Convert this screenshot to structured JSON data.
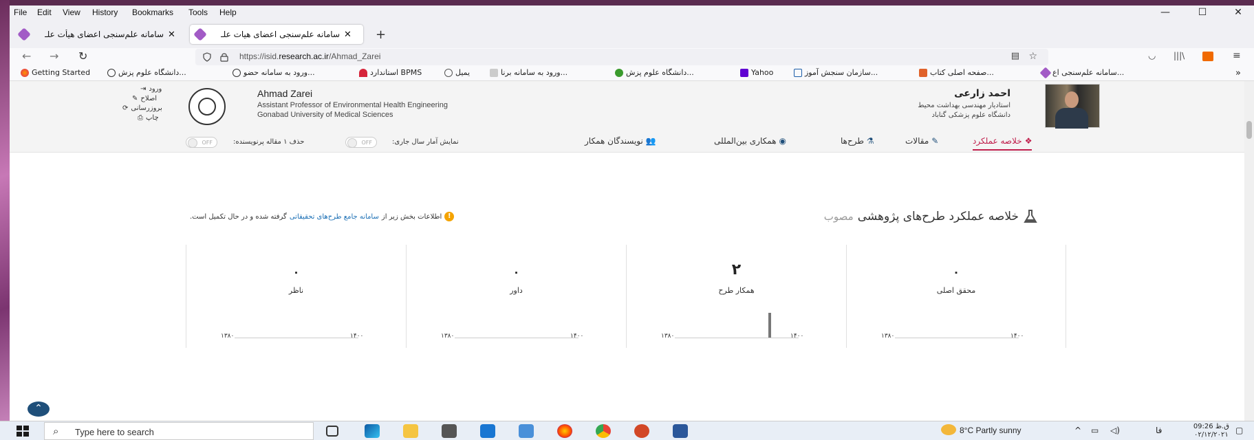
{
  "menubar": {
    "items": [
      "File",
      "Edit",
      "View",
      "History",
      "Bookmarks",
      "Tools",
      "Help"
    ],
    "minimize": "—",
    "maximize": "☐",
    "close": "✕"
  },
  "tabs": [
    {
      "title": "سامانه علم‌سنجی اعضای هیأت علـ",
      "close": "✕"
    },
    {
      "title": "سامانه علم‌سنجی اعضای هیات علـ",
      "close": "✕",
      "active": true
    }
  ],
  "newtab": "+",
  "nav": {
    "url_prefix": "https://isid.",
    "url_domain": "research.ac.ir",
    "url_path": "/Ahmad_Zarei",
    "back": "←",
    "forward": "→",
    "reload": "↻"
  },
  "bookmarks": [
    "Getting Started",
    "دانشگاه علوم پزش...",
    "ورود به سامانه حضو...",
    "استاندارد BPMS",
    "یمیل",
    "ورود به سامانه برنا...",
    "دانشگاه علوم پزش...",
    "Yahoo",
    "سازمان سنجش آموز...",
    "صفحه اصلی کتاب...",
    "سامانه علم‌سنجی اع..."
  ],
  "profile": {
    "en_name": "Ahmad Zarei",
    "en_title": "Assistant Professor of Environmental Health Engineering",
    "en_univ": "Gonabad University of Medical Sciences",
    "fa_name": "احمد زارعی",
    "fa_title": "استادیار مهندسی بهداشت محیط",
    "fa_univ": "دانشگاه علوم پزشکی گناباد",
    "links": {
      "login": "ورود",
      "edit": "اصلاح",
      "update": "بروزرسانی",
      "print": "چاپ"
    }
  },
  "page_tabs": {
    "summary": "خلاصه عملکرد",
    "articles": "مقالات",
    "projects": "طرح‌ها",
    "intl": "همکاری بین‌المللی",
    "coauthors": "نویسندگان همکار"
  },
  "toggles": {
    "current_year_label": "نمایش آمار سال جاری:",
    "remove_label": "حذف ۱ مقاله پرنویسنده:",
    "state": "OFF"
  },
  "section": {
    "title": "خلاصه عملکرد طرح‌های پژوهشی",
    "title_suffix": "مصوب",
    "notice_pre": "اطلاعات بخش زیر از",
    "notice_link": "سامانه جامع طرح‌های تحقیقاتی",
    "notice_post": "گرفته شده و در حال تکمیل است.",
    "notice_icon": "!"
  },
  "cards": [
    {
      "label": "ناظر",
      "value": "۰",
      "tick_start": "۱۳۸۰",
      "tick_end": "۱۴۰۰"
    },
    {
      "label": "داور",
      "value": "۰",
      "tick_start": "۱۳۸۰",
      "tick_end": "۱۴۰۰"
    },
    {
      "label": "همکار طرح",
      "value": "۲",
      "tick_start": "۱۳۸۰",
      "tick_end": "۱۴۰۰",
      "spark_peak_fraction": 0.7
    },
    {
      "label": "محقق اصلی",
      "value": "۰",
      "tick_start": "۱۳۸۰",
      "tick_end": "۱۴۰۰"
    }
  ],
  "scrolltop_glyph": "⌃",
  "taskbar": {
    "search_placeholder": "Type here to search",
    "weather": "8°C  Partly sunny",
    "lang": "فا",
    "time": "09:26 ق.ظ",
    "date": "۰۲/۱۲/۲۰۲۱"
  },
  "colors": {
    "accent": "#c0204d",
    "link": "#1b6fb5",
    "warn": "#f4a300"
  }
}
